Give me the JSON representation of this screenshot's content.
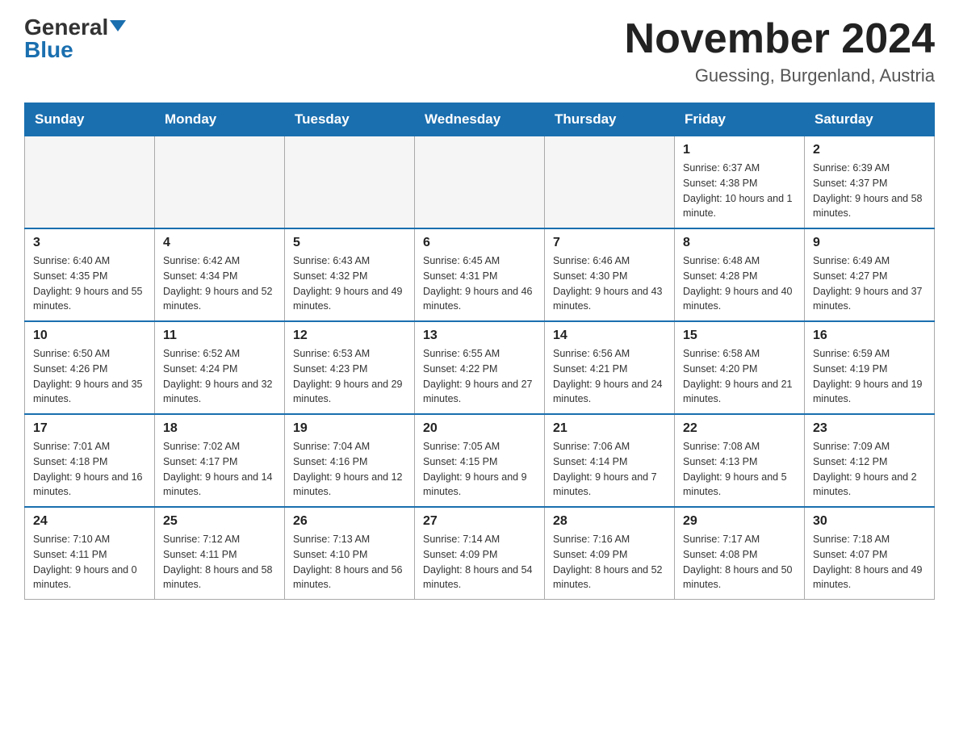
{
  "header": {
    "logo_general": "General",
    "logo_blue": "Blue",
    "month_title": "November 2024",
    "location": "Guessing, Burgenland, Austria"
  },
  "weekdays": [
    "Sunday",
    "Monday",
    "Tuesday",
    "Wednesday",
    "Thursday",
    "Friday",
    "Saturday"
  ],
  "weeks": [
    [
      {
        "day": "",
        "info": ""
      },
      {
        "day": "",
        "info": ""
      },
      {
        "day": "",
        "info": ""
      },
      {
        "day": "",
        "info": ""
      },
      {
        "day": "",
        "info": ""
      },
      {
        "day": "1",
        "info": "Sunrise: 6:37 AM\nSunset: 4:38 PM\nDaylight: 10 hours and 1 minute."
      },
      {
        "day": "2",
        "info": "Sunrise: 6:39 AM\nSunset: 4:37 PM\nDaylight: 9 hours and 58 minutes."
      }
    ],
    [
      {
        "day": "3",
        "info": "Sunrise: 6:40 AM\nSunset: 4:35 PM\nDaylight: 9 hours and 55 minutes."
      },
      {
        "day": "4",
        "info": "Sunrise: 6:42 AM\nSunset: 4:34 PM\nDaylight: 9 hours and 52 minutes."
      },
      {
        "day": "5",
        "info": "Sunrise: 6:43 AM\nSunset: 4:32 PM\nDaylight: 9 hours and 49 minutes."
      },
      {
        "day": "6",
        "info": "Sunrise: 6:45 AM\nSunset: 4:31 PM\nDaylight: 9 hours and 46 minutes."
      },
      {
        "day": "7",
        "info": "Sunrise: 6:46 AM\nSunset: 4:30 PM\nDaylight: 9 hours and 43 minutes."
      },
      {
        "day": "8",
        "info": "Sunrise: 6:48 AM\nSunset: 4:28 PM\nDaylight: 9 hours and 40 minutes."
      },
      {
        "day": "9",
        "info": "Sunrise: 6:49 AM\nSunset: 4:27 PM\nDaylight: 9 hours and 37 minutes."
      }
    ],
    [
      {
        "day": "10",
        "info": "Sunrise: 6:50 AM\nSunset: 4:26 PM\nDaylight: 9 hours and 35 minutes."
      },
      {
        "day": "11",
        "info": "Sunrise: 6:52 AM\nSunset: 4:24 PM\nDaylight: 9 hours and 32 minutes."
      },
      {
        "day": "12",
        "info": "Sunrise: 6:53 AM\nSunset: 4:23 PM\nDaylight: 9 hours and 29 minutes."
      },
      {
        "day": "13",
        "info": "Sunrise: 6:55 AM\nSunset: 4:22 PM\nDaylight: 9 hours and 27 minutes."
      },
      {
        "day": "14",
        "info": "Sunrise: 6:56 AM\nSunset: 4:21 PM\nDaylight: 9 hours and 24 minutes."
      },
      {
        "day": "15",
        "info": "Sunrise: 6:58 AM\nSunset: 4:20 PM\nDaylight: 9 hours and 21 minutes."
      },
      {
        "day": "16",
        "info": "Sunrise: 6:59 AM\nSunset: 4:19 PM\nDaylight: 9 hours and 19 minutes."
      }
    ],
    [
      {
        "day": "17",
        "info": "Sunrise: 7:01 AM\nSunset: 4:18 PM\nDaylight: 9 hours and 16 minutes."
      },
      {
        "day": "18",
        "info": "Sunrise: 7:02 AM\nSunset: 4:17 PM\nDaylight: 9 hours and 14 minutes."
      },
      {
        "day": "19",
        "info": "Sunrise: 7:04 AM\nSunset: 4:16 PM\nDaylight: 9 hours and 12 minutes."
      },
      {
        "day": "20",
        "info": "Sunrise: 7:05 AM\nSunset: 4:15 PM\nDaylight: 9 hours and 9 minutes."
      },
      {
        "day": "21",
        "info": "Sunrise: 7:06 AM\nSunset: 4:14 PM\nDaylight: 9 hours and 7 minutes."
      },
      {
        "day": "22",
        "info": "Sunrise: 7:08 AM\nSunset: 4:13 PM\nDaylight: 9 hours and 5 minutes."
      },
      {
        "day": "23",
        "info": "Sunrise: 7:09 AM\nSunset: 4:12 PM\nDaylight: 9 hours and 2 minutes."
      }
    ],
    [
      {
        "day": "24",
        "info": "Sunrise: 7:10 AM\nSunset: 4:11 PM\nDaylight: 9 hours and 0 minutes."
      },
      {
        "day": "25",
        "info": "Sunrise: 7:12 AM\nSunset: 4:11 PM\nDaylight: 8 hours and 58 minutes."
      },
      {
        "day": "26",
        "info": "Sunrise: 7:13 AM\nSunset: 4:10 PM\nDaylight: 8 hours and 56 minutes."
      },
      {
        "day": "27",
        "info": "Sunrise: 7:14 AM\nSunset: 4:09 PM\nDaylight: 8 hours and 54 minutes."
      },
      {
        "day": "28",
        "info": "Sunrise: 7:16 AM\nSunset: 4:09 PM\nDaylight: 8 hours and 52 minutes."
      },
      {
        "day": "29",
        "info": "Sunrise: 7:17 AM\nSunset: 4:08 PM\nDaylight: 8 hours and 50 minutes."
      },
      {
        "day": "30",
        "info": "Sunrise: 7:18 AM\nSunset: 4:07 PM\nDaylight: 8 hours and 49 minutes."
      }
    ]
  ]
}
